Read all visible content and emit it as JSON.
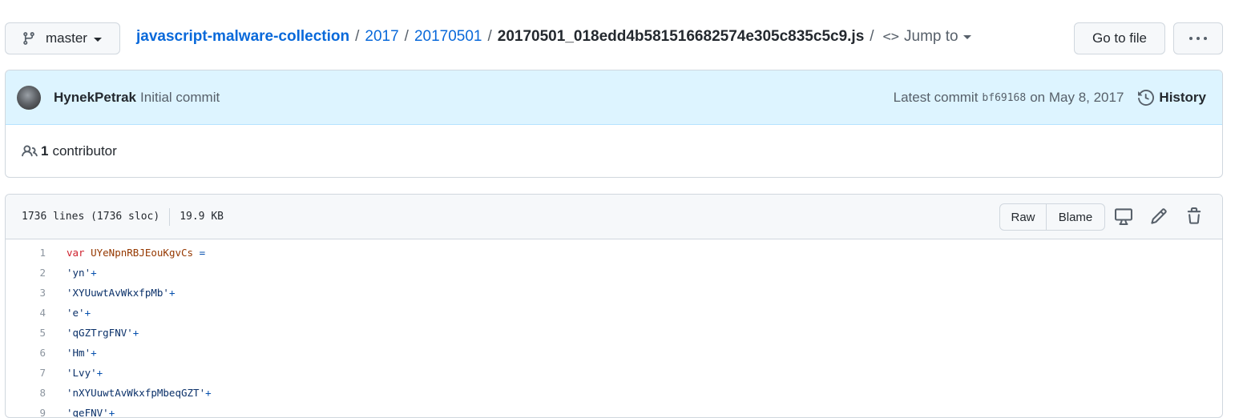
{
  "branch": {
    "label": "master",
    "icon": "git-branch-icon"
  },
  "breadcrumb": {
    "repo": "javascript-malware-collection",
    "dir1": "2017",
    "dir2": "20170501",
    "file": "20170501_018edd4b581516682574e305c835c5c9.js",
    "separator": "/",
    "jump_label": "Jump to",
    "jump_icon": "code-icon"
  },
  "actions": {
    "go_to_file": "Go to file",
    "more_icon": "kebab-horizontal-icon"
  },
  "commit": {
    "author": "HynekPetrak",
    "message": "Initial commit",
    "latest_label": "Latest commit",
    "sha": "bf69168",
    "date": "on May 8, 2017",
    "history_label": "History",
    "history_icon": "history-icon"
  },
  "contributors": {
    "count": "1",
    "label": "contributor",
    "icon": "people-icon"
  },
  "file": {
    "lines_info": "1736 lines (1736 sloc)",
    "size": "19.9 KB",
    "raw_label": "Raw",
    "blame_label": "Blame",
    "icons": [
      "desktop-icon",
      "pencil-icon",
      "trash-icon"
    ]
  },
  "code": {
    "lines": [
      {
        "num": "1",
        "keyword": "var",
        "name": "UYeNpnRBJEouKgvCs",
        "op": "="
      },
      {
        "num": "2",
        "text": "'yn'",
        "op": "+"
      },
      {
        "num": "3",
        "text": "'XYUuwtAvWkxfpMb'",
        "op": "+"
      },
      {
        "num": "4",
        "text": "'e'",
        "op": "+"
      },
      {
        "num": "5",
        "text": "'qGZTrgFNV'",
        "op": "+"
      },
      {
        "num": "6",
        "text": "'Hm'",
        "op": "+"
      },
      {
        "num": "7",
        "text": "'Lvy'",
        "op": "+"
      },
      {
        "num": "8",
        "text": "'nXYUuwtAvWkxfpMbeqGZT'",
        "op": "+"
      },
      {
        "num": "9",
        "text": "'qeFNV'",
        "op": "+"
      }
    ]
  }
}
